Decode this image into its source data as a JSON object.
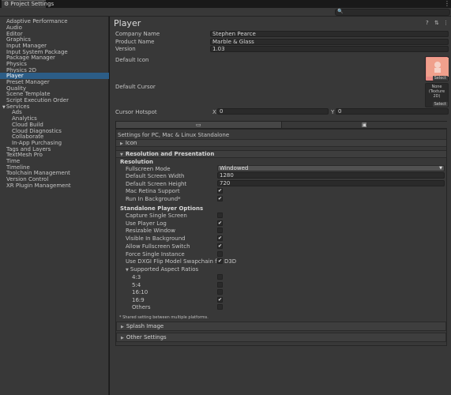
{
  "window": {
    "tab_title": "Project Settings",
    "menu_glyph": "⋮"
  },
  "sidebar": {
    "items": [
      {
        "label": "Adaptive Performance"
      },
      {
        "label": "Audio"
      },
      {
        "label": "Editor"
      },
      {
        "label": "Graphics"
      },
      {
        "label": "Input Manager"
      },
      {
        "label": "Input System Package"
      },
      {
        "label": "Package Manager"
      },
      {
        "label": "Physics"
      },
      {
        "label": "Physics 2D"
      },
      {
        "label": "Player"
      },
      {
        "label": "Preset Manager"
      },
      {
        "label": "Quality"
      },
      {
        "label": "Scene Template"
      },
      {
        "label": "Script Execution Order"
      },
      {
        "label": "Services"
      },
      {
        "label": "Ads"
      },
      {
        "label": "Analytics"
      },
      {
        "label": "Cloud Build"
      },
      {
        "label": "Cloud Diagnostics"
      },
      {
        "label": "Collaborate"
      },
      {
        "label": "In-App Purchasing"
      },
      {
        "label": "Tags and Layers"
      },
      {
        "label": "TextMesh Pro"
      },
      {
        "label": "Time"
      },
      {
        "label": "Timeline"
      },
      {
        "label": "Toolchain Management"
      },
      {
        "label": "Version Control"
      },
      {
        "label": "XR Plugin Management"
      }
    ]
  },
  "player": {
    "title": "Player",
    "company_label": "Company Name",
    "company_value": "Stephen Pearce",
    "product_label": "Product Name",
    "product_value": "Marble & Glass",
    "version_label": "Version",
    "version_value": "1.03",
    "default_icon_label": "Default Icon",
    "default_cursor_label": "Default Cursor",
    "select_label": "Select",
    "cursor_none_line1": "None",
    "cursor_none_line2": "(Texture 2D)",
    "hotspot_label": "Cursor Hotspot",
    "hotspot_x_label": "X",
    "hotspot_x": "0",
    "hotspot_y_label": "Y",
    "hotspot_y": "0",
    "settings_for": "Settings for PC, Mac & Linux Standalone"
  },
  "sections": {
    "icon": "Icon",
    "resolution_presentation": "Resolution and Presentation",
    "resolution": "Resolution",
    "fullscreen_mode_label": "Fullscreen Mode",
    "fullscreen_mode_value": "Windowed",
    "width_label": "Default Screen Width",
    "width_value": "1280",
    "height_label": "Default Screen Height",
    "height_value": "720",
    "retina_label": "Mac Retina Support",
    "run_bg_label": "Run In Background*",
    "standalone_options": "Standalone Player Options",
    "capture_label": "Capture Single Screen",
    "player_log_label": "Use Player Log",
    "resizable_label": "Resizable Window",
    "visible_bg_label": "Visible In Background",
    "fullscreen_switch_label": "Allow Fullscreen Switch",
    "single_instance_label": "Force Single Instance",
    "dxgi_label": "Use DXGI Flip Model Swapchain for D3D",
    "aspect_ratios_label": "Supported Aspect Ratios",
    "ar_4_3": "4:3",
    "ar_5_4": "5:4",
    "ar_16_10": "16:10",
    "ar_16_9": "16:9",
    "ar_others": "Others",
    "shared_note": "* Shared setting between multiple platforms.",
    "splash_image": "Splash Image",
    "other_settings": "Other Settings"
  },
  "checks": {
    "retina": true,
    "run_bg": true,
    "capture": false,
    "player_log": true,
    "resizable": false,
    "visible_bg": true,
    "fullscreen_switch": true,
    "single_instance": false,
    "dxgi": true,
    "ar_4_3": false,
    "ar_5_4": false,
    "ar_16_10": false,
    "ar_16_9": true,
    "ar_others": false
  },
  "colors": {
    "selection": "#2c5d87",
    "panel": "#383838",
    "field": "#2a2a2a"
  }
}
